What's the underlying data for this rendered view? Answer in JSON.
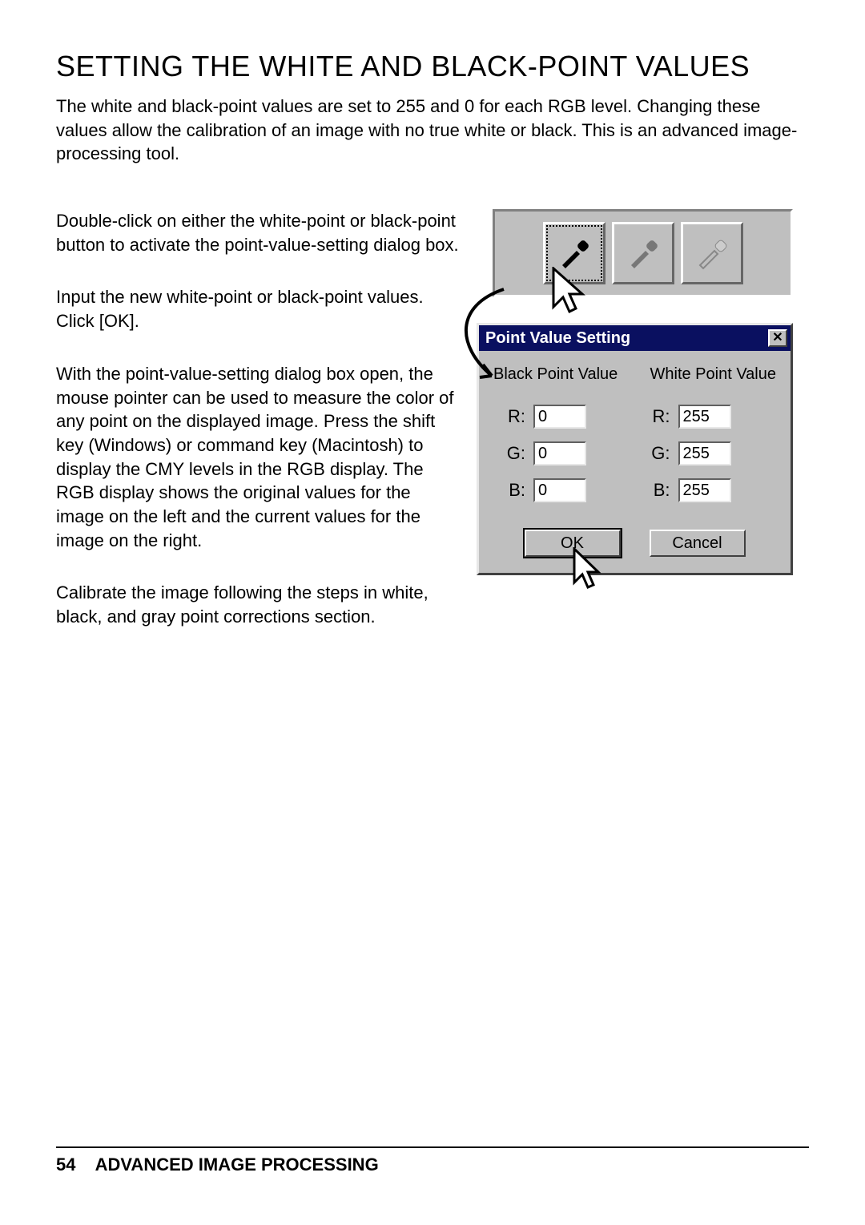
{
  "heading": "SETTING THE WHITE AND BLACK-POINT VALUES",
  "intro": "The white and black-point values are set to 255 and 0 for each RGB level. Changing these values allow the calibration of an image with no true white or black. This is an advanced image-processing tool.",
  "paragraphs": {
    "p1": "Double-click on either the white-point or black-point button to activate the point-value-setting dialog box.",
    "p2": "Input the new white-point or black-point values. Click [OK].",
    "p3": "With the point-value-setting dialog box open, the mouse pointer can be used to measure the color of any point on the displayed image. Press the shift key (Windows) or command key (Macintosh) to display the CMY levels in the RGB display. The RGB display shows the original values for the image on the left and the current values for the image on the right.",
    "p4": "Calibrate the image following the steps in white, black, and gray point corrections section."
  },
  "dialog": {
    "title": "Point Value Setting",
    "close_glyph": "✕",
    "black_header": "Black Point Value",
    "white_header": "White Point Value",
    "labels": {
      "r": "R:",
      "g": "G:",
      "b": "B:"
    },
    "black": {
      "r": "0",
      "g": "0",
      "b": "0"
    },
    "white": {
      "r": "255",
      "g": "255",
      "b": "255"
    },
    "ok_label": "OK",
    "cancel_label": "Cancel"
  },
  "footer": {
    "page_number": "54",
    "section": "ADVANCED IMAGE PROCESSING"
  }
}
